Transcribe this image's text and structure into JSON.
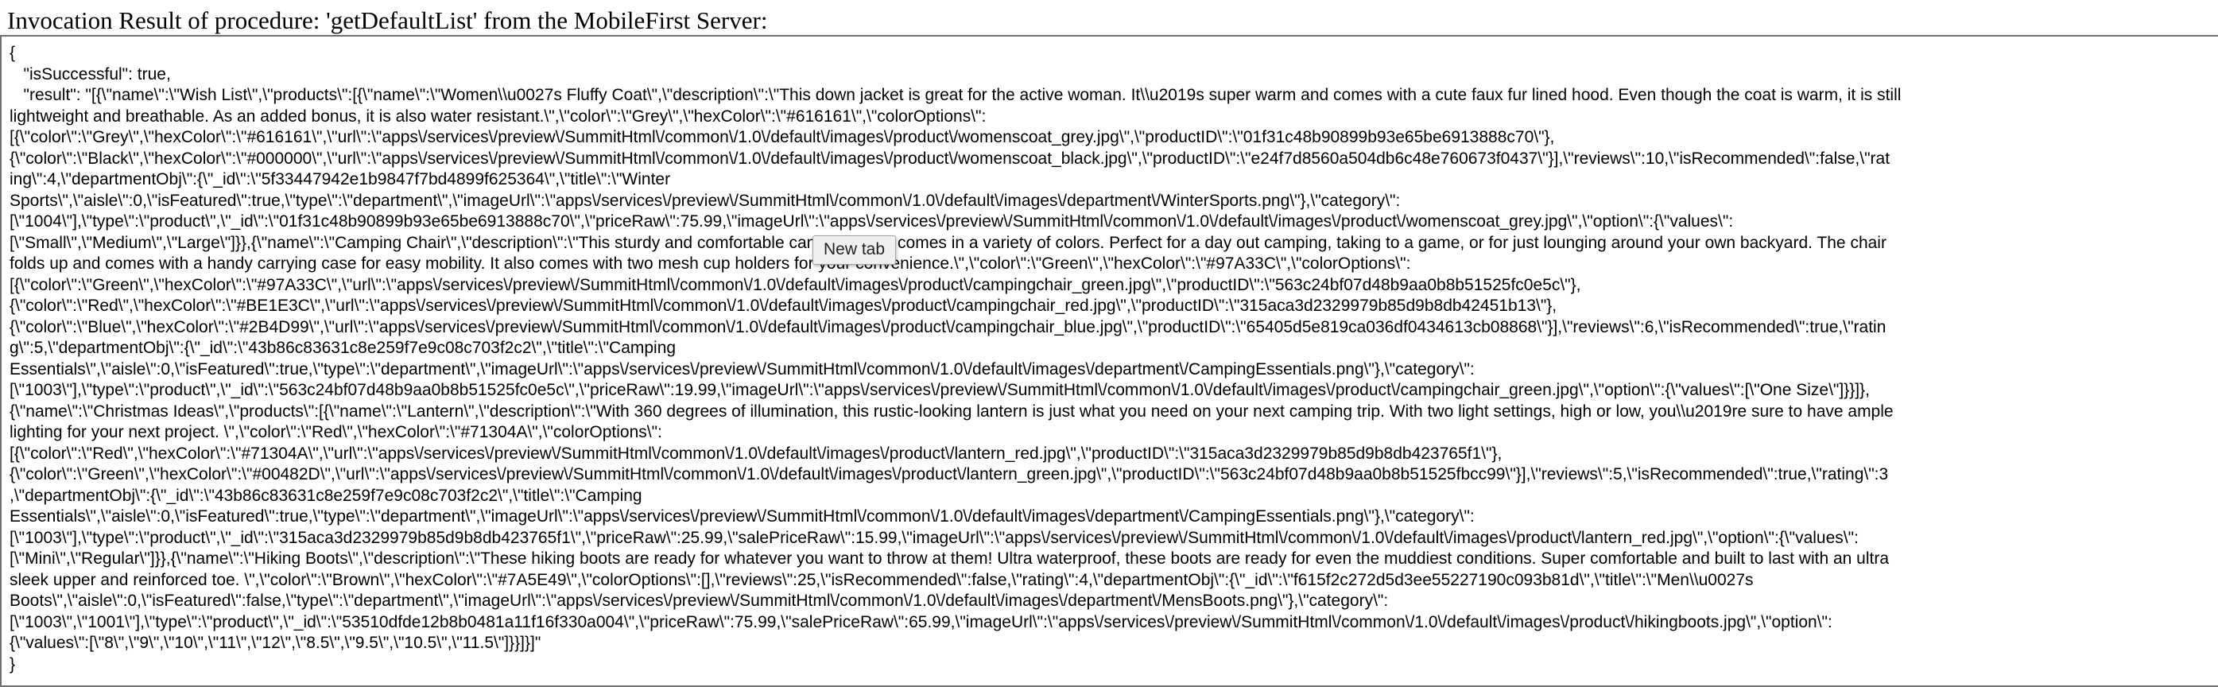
{
  "page": {
    "title": "Invocation Result of procedure: 'getDefaultList' from the MobileFirst Server:"
  },
  "result_lines": [
    "{",
    "   \"isSuccessful\": true,",
    "   \"result\": \"[{\\\"name\\\":\\\"Wish List\\\",\\\"products\\\":[{\\\"name\\\":\\\"Women\\\\u0027s Fluffy Coat\\\",\\\"description\\\":\\\"This down jacket is great for the active woman. It\\\\u2019s super warm and comes with a cute faux fur lined hood. Even though the coat is warm, it is still",
    "lightweight and breathable. As an added bonus, it is also water resistant.\\\",\\\"color\\\":\\\"Grey\\\",\\\"hexColor\\\":\\\"#616161\\\",\\\"colorOptions\\\":",
    "[{\\\"color\\\":\\\"Grey\\\",\\\"hexColor\\\":\\\"#616161\\\",\\\"url\\\":\\\"apps\\/services\\/preview\\/SummitHtml\\/common\\/1.0\\/default\\/images\\/product\\/womenscoat_grey.jpg\\\",\\\"productID\\\":\\\"01f31c48b90899b93e65be6913888c70\\\"},",
    "{\\\"color\\\":\\\"Black\\\",\\\"hexColor\\\":\\\"#000000\\\",\\\"url\\\":\\\"apps\\/services\\/preview\\/SummitHtml\\/common\\/1.0\\/default\\/images\\/product\\/womenscoat_black.jpg\\\",\\\"productID\\\":\\\"e24f7d8560a504db6c48e760673f0437\\\"}],\\\"reviews\\\":10,\\\"isRecommended\\\":false,\\\"rat",
    "ing\\\":4,\\\"departmentObj\\\":{\\\"_id\\\":\\\"5f33447942e1b9847f7bd4899f625364\\\",\\\"title\\\":\\\"Winter",
    "Sports\\\",\\\"aisle\\\":0,\\\"isFeatured\\\":true,\\\"type\\\":\\\"department\\\",\\\"imageUrl\\\":\\\"apps\\/services\\/preview\\/SummitHtml\\/common\\/1.0\\/default\\/images\\/department\\/WinterSports.png\\\"},\\\"category\\\":",
    "[\\\"1004\\\"],\\\"type\\\":\\\"product\\\",\\\"_id\\\":\\\"01f31c48b90899b93e65be6913888c70\\\",\\\"priceRaw\\\":75.99,\\\"imageUrl\\\":\\\"apps\\/services\\/preview\\/SummitHtml\\/common\\/1.0\\/default\\/images\\/product\\/womenscoat_grey.jpg\\\",\\\"option\\\":{\\\"values\\\":",
    "[\\\"Small\\\",\\\"Medium\\\",\\\"Large\\\"]}},{\\\"name\\\":\\\"Camping Chair\\\",\\\"description\\\":\\\"This sturdy and comfortable camping chair comes in a variety of colors. Perfect for a day out camping, taking to a game, or for just lounging around your own backyard. The chair",
    "folds up and comes with a handy carrying case for easy mobility. It also comes with two mesh cup holders for your convenience.\\\",\\\"color\\\":\\\"Green\\\",\\\"hexColor\\\":\\\"#97A33C\\\",\\\"colorOptions\\\":",
    "[{\\\"color\\\":\\\"Green\\\",\\\"hexColor\\\":\\\"#97A33C\\\",\\\"url\\\":\\\"apps\\/services\\/preview\\/SummitHtml\\/common\\/1.0\\/default\\/images\\/product\\/campingchair_green.jpg\\\",\\\"productID\\\":\\\"563c24bf07d48b9aa0b8b51525fc0e5c\\\"},",
    "{\\\"color\\\":\\\"Red\\\",\\\"hexColor\\\":\\\"#BE1E3C\\\",\\\"url\\\":\\\"apps\\/services\\/preview\\/SummitHtml\\/common\\/1.0\\/default\\/images\\/product\\/campingchair_red.jpg\\\",\\\"productID\\\":\\\"315aca3d2329979b85d9b8db42451b13\\\"},",
    "{\\\"color\\\":\\\"Blue\\\",\\\"hexColor\\\":\\\"#2B4D99\\\",\\\"url\\\":\\\"apps\\/services\\/preview\\/SummitHtml\\/common\\/1.0\\/default\\/images\\/product\\/campingchair_blue.jpg\\\",\\\"productID\\\":\\\"65405d5e819ca036df0434613cb08868\\\"}],\\\"reviews\\\":6,\\\"isRecommended\\\":true,\\\"ratin",
    "g\\\":5,\\\"departmentObj\\\":{\\\"_id\\\":\\\"43b86c83631c8e259f7e9c08c703f2c2\\\",\\\"title\\\":\\\"Camping",
    "Essentials\\\",\\\"aisle\\\":0,\\\"isFeatured\\\":true,\\\"type\\\":\\\"department\\\",\\\"imageUrl\\\":\\\"apps\\/services\\/preview\\/SummitHtml\\/common\\/1.0\\/default\\/images\\/department\\/CampingEssentials.png\\\"},\\\"category\\\":",
    "[\\\"1003\\\"],\\\"type\\\":\\\"product\\\",\\\"_id\\\":\\\"563c24bf07d48b9aa0b8b51525fc0e5c\\\",\\\"priceRaw\\\":19.99,\\\"imageUrl\\\":\\\"apps\\/services\\/preview\\/SummitHtml\\/common\\/1.0\\/default\\/images\\/product\\/campingchair_green.jpg\\\",\\\"option\\\":{\\\"values\\\":[\\\"One Size\\\"]}}]},",
    "{\\\"name\\\":\\\"Christmas Ideas\\\",\\\"products\\\":[{\\\"name\\\":\\\"Lantern\\\",\\\"description\\\":\\\"With 360 degrees of illumination, this rustic-looking lantern is just what you need on your next camping trip. With two light settings, high or low, you\\\\u2019re sure to have ample",
    "lighting for your next project. \\\",\\\"color\\\":\\\"Red\\\",\\\"hexColor\\\":\\\"#71304A\\\",\\\"colorOptions\\\":",
    "[{\\\"color\\\":\\\"Red\\\",\\\"hexColor\\\":\\\"#71304A\\\",\\\"url\\\":\\\"apps\\/services\\/preview\\/SummitHtml\\/common\\/1.0\\/default\\/images\\/product\\/lantern_red.jpg\\\",\\\"productID\\\":\\\"315aca3d2329979b85d9b8db423765f1\\\"},",
    "{\\\"color\\\":\\\"Green\\\",\\\"hexColor\\\":\\\"#00482D\\\",\\\"url\\\":\\\"apps\\/services\\/preview\\/SummitHtml\\/common\\/1.0\\/default\\/images\\/product\\/lantern_green.jpg\\\",\\\"productID\\\":\\\"563c24bf07d48b9aa0b8b51525fbcc99\\\"}],\\\"reviews\\\":5,\\\"isRecommended\\\":true,\\\"rating\\\":3",
    ",\\\"departmentObj\\\":{\\\"_id\\\":\\\"43b86c83631c8e259f7e9c08c703f2c2\\\",\\\"title\\\":\\\"Camping",
    "Essentials\\\",\\\"aisle\\\":0,\\\"isFeatured\\\":true,\\\"type\\\":\\\"department\\\",\\\"imageUrl\\\":\\\"apps\\/services\\/preview\\/SummitHtml\\/common\\/1.0\\/default\\/images\\/department\\/CampingEssentials.png\\\"},\\\"category\\\":",
    "[\\\"1003\\\"],\\\"type\\\":\\\"product\\\",\\\"_id\\\":\\\"315aca3d2329979b85d9b8db423765f1\\\",\\\"priceRaw\\\":25.99,\\\"salePriceRaw\\\":15.99,\\\"imageUrl\\\":\\\"apps\\/services\\/preview\\/SummitHtml\\/common\\/1.0\\/default\\/images\\/product\\/lantern_red.jpg\\\",\\\"option\\\":{\\\"values\\\":",
    "[\\\"Mini\\\",\\\"Regular\\\"]}},{\\\"name\\\":\\\"Hiking Boots\\\",\\\"description\\\":\\\"These hiking boots are ready for whatever you want to throw at them! Ultra waterproof, these boots are ready for even the muddiest conditions. Super comfortable and built to last with an ultra",
    "sleek upper and reinforced toe. \\\",\\\"color\\\":\\\"Brown\\\",\\\"hexColor\\\":\\\"#7A5E49\\\",\\\"colorOptions\\\":[],\\\"reviews\\\":25,\\\"isRecommended\\\":false,\\\"rating\\\":4,\\\"departmentObj\\\":{\\\"_id\\\":\\\"f615f2c272d5d3ee55227190c093b81d\\\",\\\"title\\\":\\\"Men\\\\u0027s",
    "Boots\\\",\\\"aisle\\\":0,\\\"isFeatured\\\":false,\\\"type\\\":\\\"department\\\",\\\"imageUrl\\\":\\\"apps\\/services\\/preview\\/SummitHtml\\/common\\/1.0\\/default\\/images\\/department\\/MensBoots.png\\\"},\\\"category\\\":",
    "[\\\"1003\\\",\\\"1001\\\"],\\\"type\\\":\\\"product\\\",\\\"_id\\\":\\\"53510dfde12b8b0481a11f16f330a004\\\",\\\"priceRaw\\\":75.99,\\\"salePriceRaw\\\":65.99,\\\"imageUrl\\\":\\\"apps\\/services\\/preview\\/SummitHtml\\/common\\/1.0\\/default\\/images\\/product\\/hikingboots.jpg\\\",\\\"option\\\":",
    "{\\\"values\\\":[\\\"8\\\",\\\"9\\\",\\\"10\\\",\\\"11\\\",\\\"12\\\",\\\"8.5\\\",\\\"9.5\\\",\\\"10.5\\\",\\\"11.5\\\"]}}]}]\"",
    "}"
  ],
  "tooltip": {
    "label": "New tab"
  }
}
